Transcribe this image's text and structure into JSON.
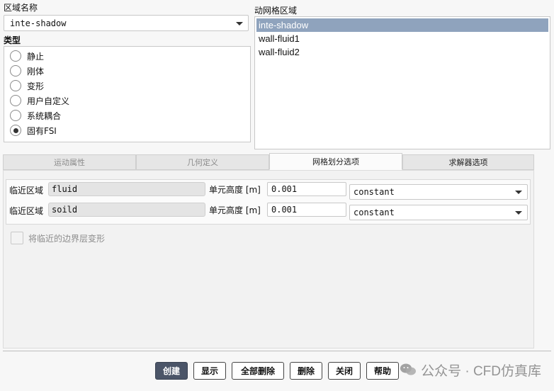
{
  "zone": {
    "label": "区域名称",
    "value": "inte-shadow"
  },
  "type_group": {
    "label": "类型",
    "options": [
      {
        "label": "静止",
        "checked": false
      },
      {
        "label": "刚体",
        "checked": false
      },
      {
        "label": "变形",
        "checked": false
      },
      {
        "label": "用户自定义",
        "checked": false
      },
      {
        "label": "系统耦合",
        "checked": false
      },
      {
        "label": "固有FSI",
        "checked": true
      }
    ]
  },
  "dynamic_zones": {
    "label": "动网格区域",
    "items": [
      "inte-shadow",
      "wall-fluid1",
      "wall-fluid2"
    ],
    "selected": "inte-shadow"
  },
  "tabs": [
    {
      "label": "运动属性",
      "state": "disabled"
    },
    {
      "label": "几何定义",
      "state": "disabled"
    },
    {
      "label": "网格划分选项",
      "state": "active"
    },
    {
      "label": "求解器选项",
      "state": "normal"
    }
  ],
  "mesh_rows": [
    {
      "adjacent_label": "临近区域",
      "adjacent_value": "fluid",
      "height_label": "单元高度 [m]",
      "height_value": "0.001",
      "mode": "constant"
    },
    {
      "adjacent_label": "临近区域",
      "adjacent_value": "soild",
      "height_label": "单元高度 [m]",
      "height_value": "0.001",
      "mode": "constant"
    }
  ],
  "deform_checkbox": {
    "label": "将临近的边界层变形",
    "checked": false
  },
  "buttons": {
    "create": "创建",
    "display": "显示",
    "delete_all": "全部删除",
    "delete": "删除",
    "close": "关闭",
    "help": "帮助"
  },
  "watermark": "公众号 · CFD仿真库",
  "colors": {
    "selected_row": "#8fa3bd",
    "primary_button": "#4b5568"
  }
}
